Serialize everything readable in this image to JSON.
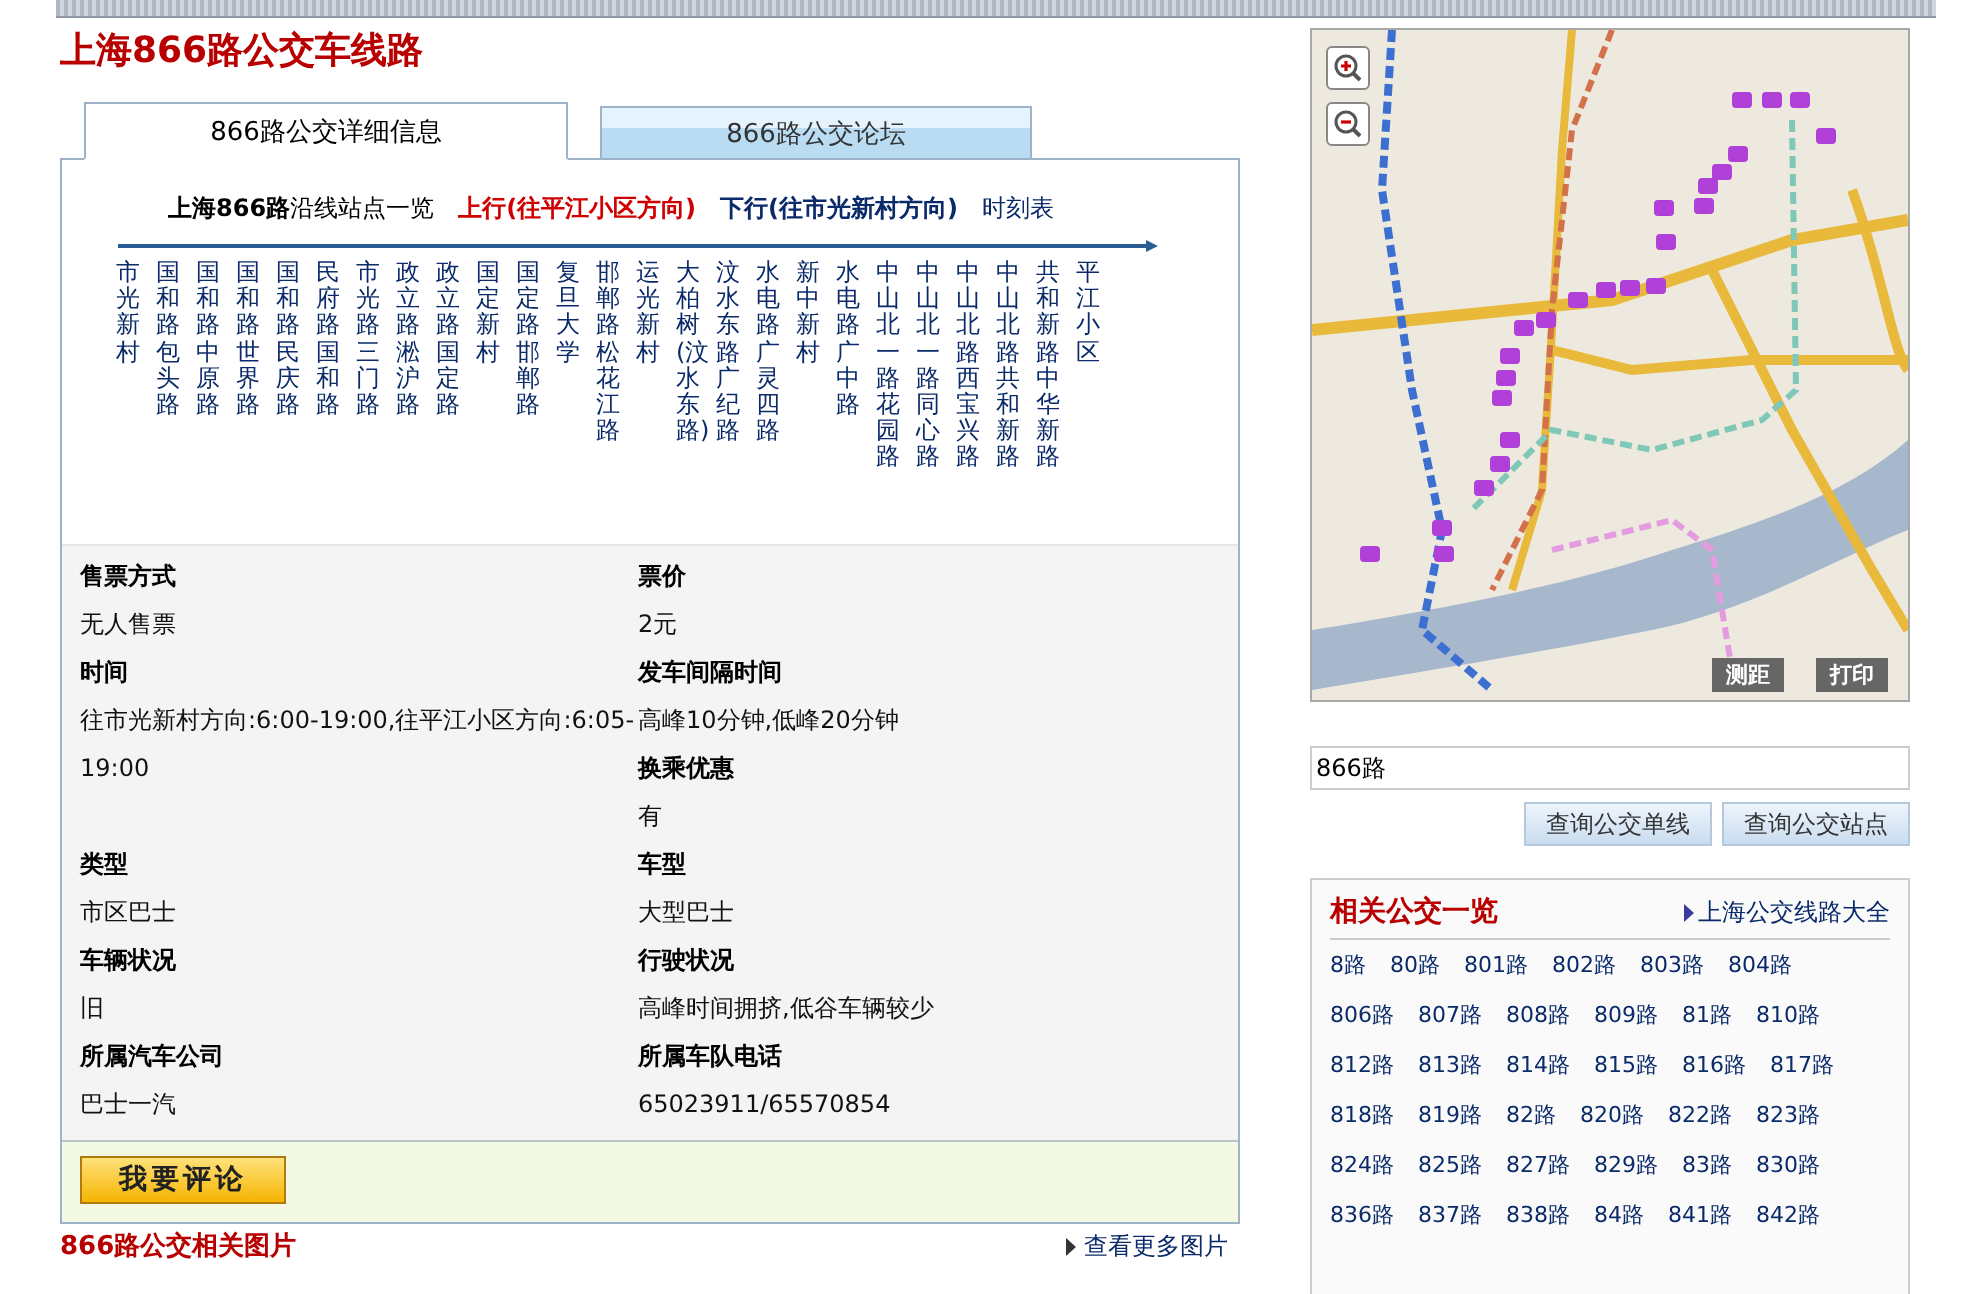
{
  "page_title": "上海866路公交车线路",
  "tabs": [
    {
      "label": "866路公交详细信息",
      "selected": true
    },
    {
      "label": "866路公交论坛",
      "selected": false
    }
  ],
  "stations_header": {
    "title": "**上海866路**沿线站点一览",
    "directions": [
      {
        "label": "上行(往平江小区方向)",
        "selected": true
      },
      {
        "label": "下行(往市光新村方向)",
        "selected": false
      }
    ],
    "timetable_link": "时刻表"
  },
  "stations": [
    "市光新村",
    "国和路包头路",
    "国和路中原路",
    "国和路世界路",
    "国和路民庆路",
    "民府路国和路",
    "市光路三门路",
    "政立路淞沪路",
    "政立路国定路",
    "国定新村",
    "国定路邯郸路",
    "复旦大学",
    "邯郸路松花江路",
    "运光新村",
    "大柏树(汶水东路)",
    "汶水东路广纪路",
    "水电路广灵四路",
    "新中新村",
    "水电路广中路",
    "中山北一路花园路",
    "中山北一路同心路",
    "中山北路西宝兴路",
    "中山北路共和新路",
    "共和新路中华新路",
    "平江小区"
  ],
  "details": [
    {
      "left": {
        "label": "售票方式",
        "value": "无人售票"
      },
      "right": [
        {
          "label": "票价",
          "value": "2元"
        }
      ]
    },
    {
      "left": {
        "label": "时间",
        "value": "往市光新村方向:6:00-19:00,往平江小区方向:6:05-19:00"
      },
      "right": [
        {
          "label": "发车间隔时间",
          "value": "高峰10分钟,低峰20分钟"
        },
        {
          "label": "换乘优惠",
          "value": "有"
        }
      ]
    },
    {
      "left": {
        "label": "类型",
        "value": "市区巴士"
      },
      "right": [
        {
          "label": "车型",
          "value": "大型巴士"
        }
      ]
    },
    {
      "left": {
        "label": "车辆状况",
        "value": "旧"
      },
      "right": [
        {
          "label": "行驶状况",
          "value": "高峰时间拥挤,低谷车辆较少"
        }
      ]
    },
    {
      "left": {
        "label": "所属汽车公司",
        "value": "巴士一汽"
      },
      "right": [
        {
          "label": "所属车队电话",
          "value": "65023911/65570854"
        }
      ]
    }
  ],
  "comment_button": "我要评论",
  "photos_section": {
    "title": "866路公交相关图片",
    "more_link": "查看更多图片"
  },
  "map": {
    "measure_button": "测距",
    "print_button": "打印"
  },
  "search": {
    "value": "866路",
    "buttons": [
      "查询公交单线",
      "查询公交站点"
    ]
  },
  "related": {
    "title": "相关公交一览",
    "all_link": "上海公交线路大全",
    "routes": [
      "8路",
      "80路",
      "801路",
      "802路",
      "803路",
      "804路",
      "806路",
      "807路",
      "808路",
      "809路",
      "81路",
      "810路",
      "812路",
      "813路",
      "814路",
      "815路",
      "816路",
      "817路",
      "818路",
      "819路",
      "82路",
      "820路",
      "822路",
      "823路",
      "824路",
      "825路",
      "827路",
      "829路",
      "83路",
      "830路",
      "836路",
      "837路",
      "838路",
      "84路",
      "841路",
      "842路"
    ]
  }
}
